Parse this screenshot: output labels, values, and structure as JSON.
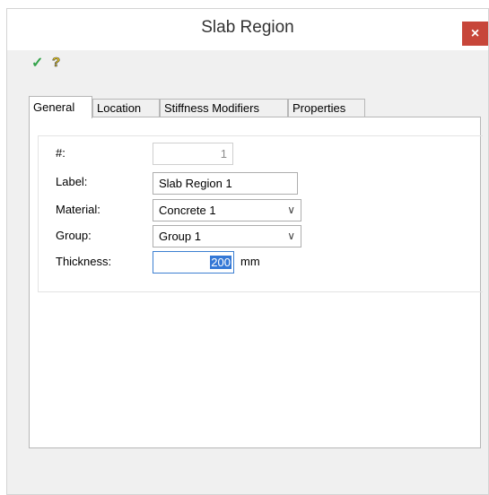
{
  "window": {
    "title": "Slab Region",
    "close_label": "×"
  },
  "toolbar": {
    "ok_icon": "checkmark-icon",
    "help_icon": "help-icon",
    "ok_glyph": "✓",
    "help_glyph": "?"
  },
  "tabs": [
    {
      "label": "General",
      "active": true
    },
    {
      "label": "Location",
      "active": false
    },
    {
      "label": "Stiffness Modifiers",
      "active": false
    },
    {
      "label": "Properties",
      "active": false
    }
  ],
  "form": {
    "number_label": "#:",
    "number_value": "1",
    "label_label": "Label:",
    "label_value": "Slab Region 1",
    "material_label": "Material:",
    "material_value": "Concrete 1",
    "group_label": "Group:",
    "group_value": "Group 1",
    "thickness_label": "Thickness:",
    "thickness_value": "200",
    "thickness_unit": "mm"
  },
  "colors": {
    "close_bg": "#c7463a",
    "ok_green": "#33a34a",
    "selection_blue": "#3478d6"
  }
}
